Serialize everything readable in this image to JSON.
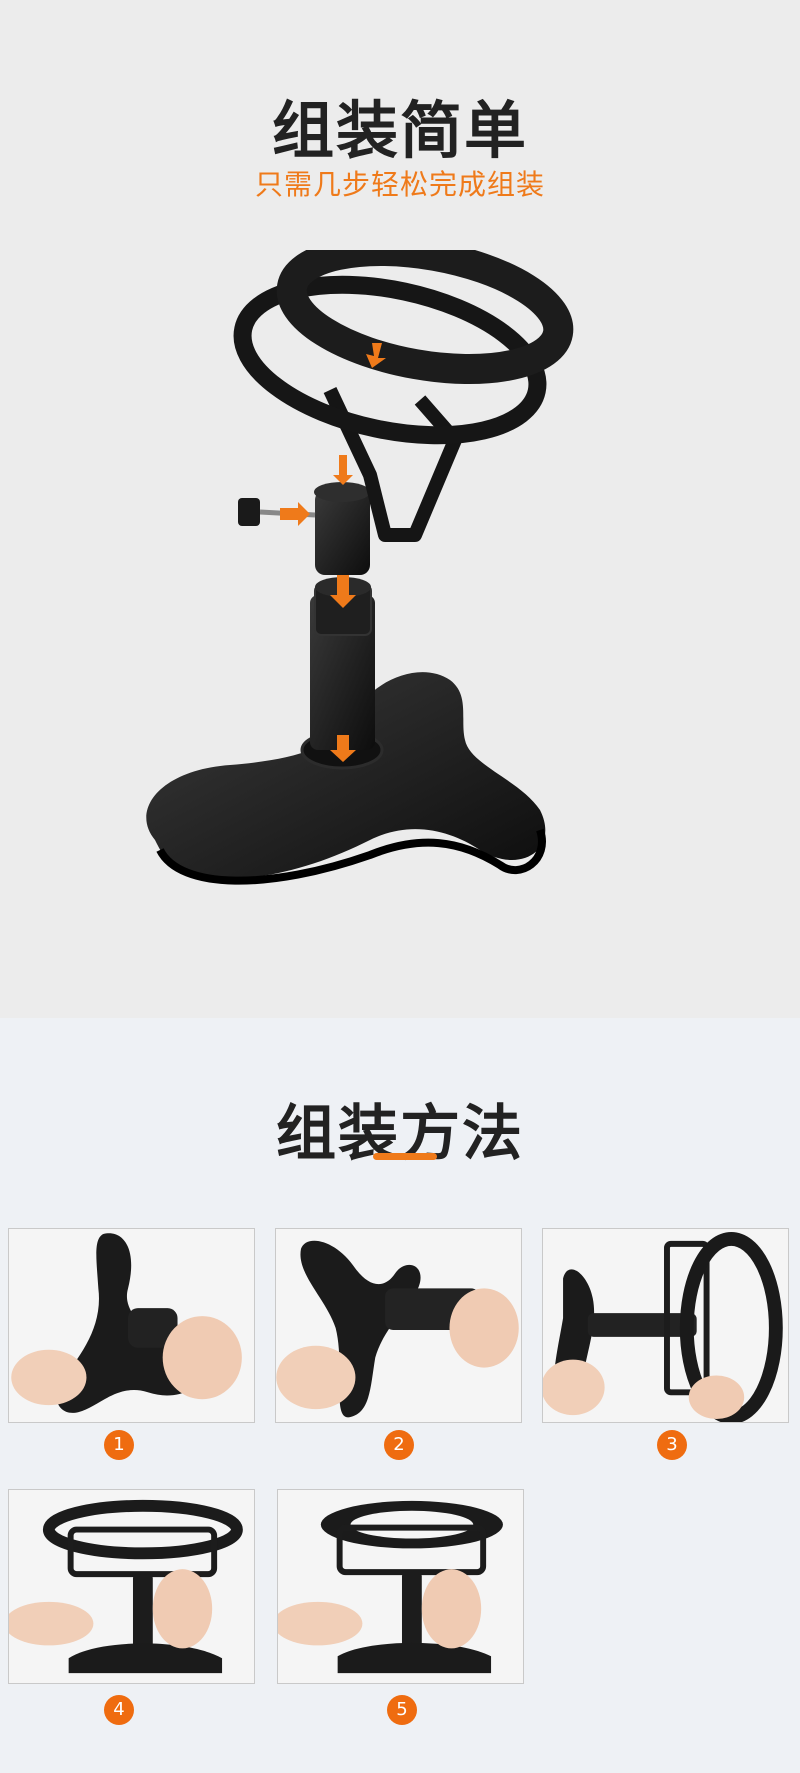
{
  "header": {
    "title": "组装简单",
    "subtitle": "只需几步轻松完成组装"
  },
  "method": {
    "title": "组装方法"
  },
  "steps": [
    {
      "number": "1"
    },
    {
      "number": "2"
    },
    {
      "number": "3"
    },
    {
      "number": "4"
    },
    {
      "number": "5"
    }
  ],
  "colors": {
    "accent": "#ef7a1a",
    "badge": "#ef6c10",
    "top_background": "#ececec",
    "bottom_background": "#eef1f5",
    "product": "#1a1a1a"
  }
}
